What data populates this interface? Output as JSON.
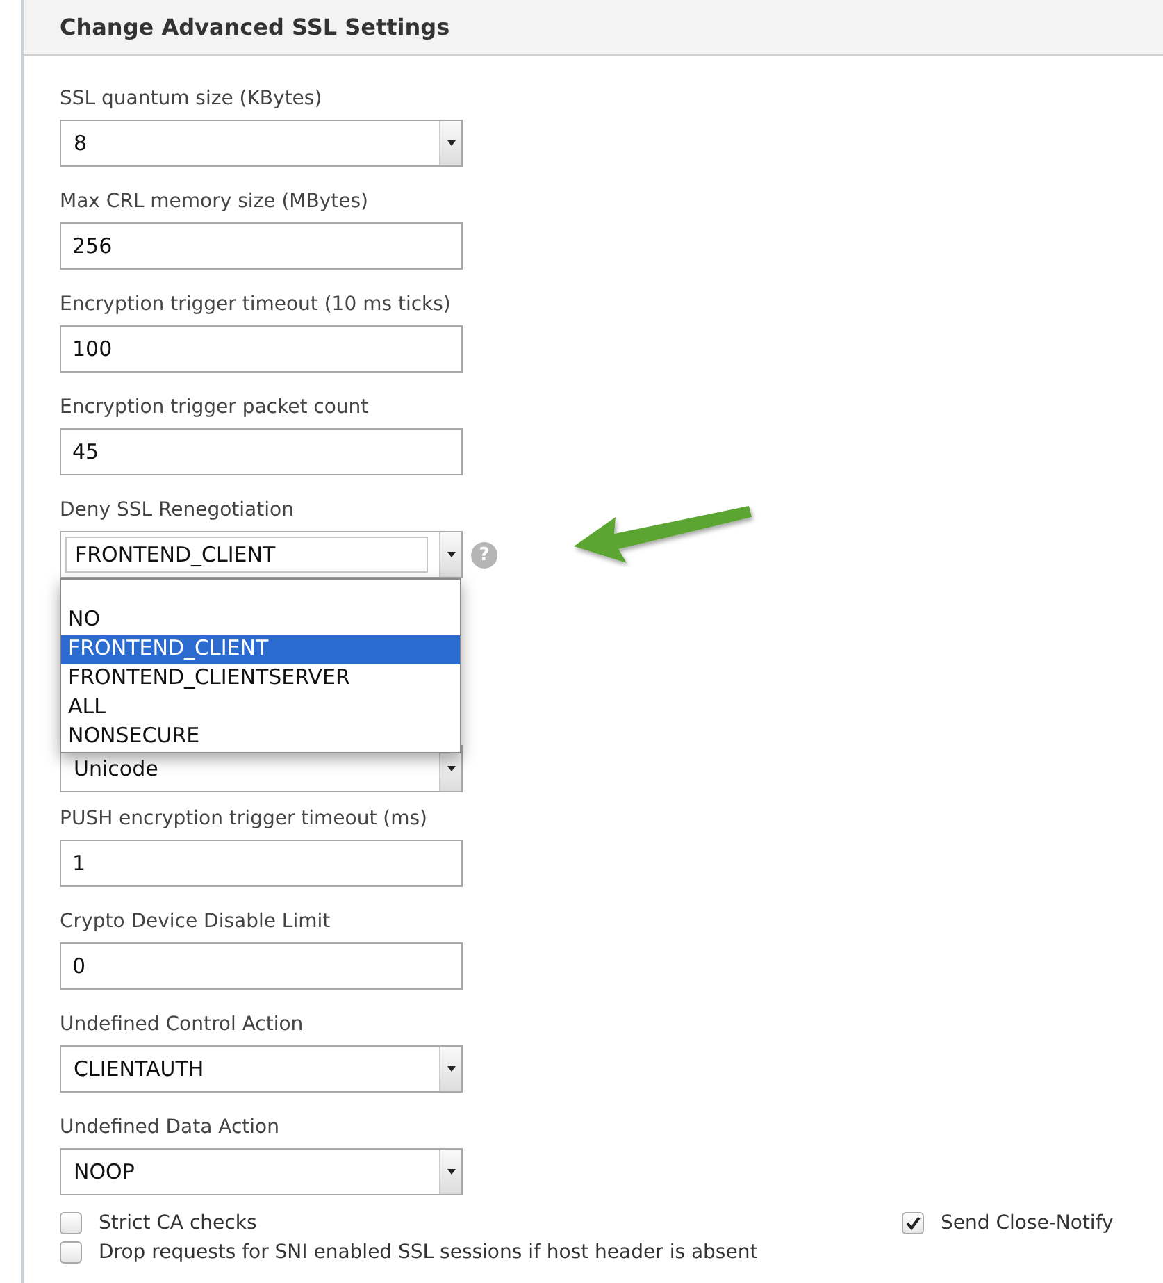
{
  "panel": {
    "title": "Change Advanced SSL Settings"
  },
  "fields": [
    {
      "kind": "select",
      "label": "SSL quantum size (KBytes)",
      "value": "8"
    },
    {
      "kind": "input",
      "label": "Max CRL memory size (MBytes)",
      "value": "256"
    },
    {
      "kind": "input",
      "label": "Encryption trigger timeout (10 ms ticks)",
      "value": "100"
    },
    {
      "kind": "input",
      "label": "Encryption trigger packet count",
      "value": "45"
    },
    {
      "kind": "combo",
      "label": "Deny SSL Renegotiation",
      "value": "FRONTEND_CLIENT",
      "help": "?",
      "expanded": true,
      "options": [
        {
          "label": "NO",
          "selected": false
        },
        {
          "label": "FRONTEND_CLIENT",
          "selected": true
        },
        {
          "label": "FRONTEND_CLIENTSERVER",
          "selected": false
        },
        {
          "label": "ALL",
          "selected": false
        },
        {
          "label": "NONSECURE",
          "selected": false
        }
      ]
    },
    {
      "kind": "select",
      "value": "Unicode"
    },
    {
      "kind": "input",
      "label": "PUSH encryption trigger timeout (ms)",
      "value": "1"
    },
    {
      "kind": "input",
      "label": "Crypto Device Disable Limit",
      "value": "0"
    },
    {
      "kind": "select",
      "label": "Undefined Control Action",
      "value": "CLIENTAUTH"
    },
    {
      "kind": "select",
      "label": "Undefined Data Action",
      "value": "NOOP"
    }
  ],
  "checkboxes": [
    {
      "label": "Strict CA checks",
      "checked": false
    },
    {
      "label": "Send Close-Notify",
      "checked": true
    },
    {
      "label": "Drop requests for SNI enabled SSL sessions if host header is absent",
      "checked": false
    }
  ]
}
